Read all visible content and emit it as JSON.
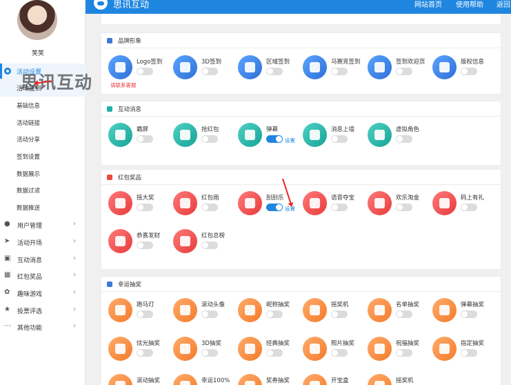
{
  "user": {
    "name": "笑笑"
  },
  "sidebar": {
    "top_item": "活动设置",
    "top_sub": "活动签到",
    "sub_items": [
      "基础信息",
      "活动链接",
      "活动分享",
      "签到设置",
      "数据展示",
      "数据过滤",
      "数据推送"
    ],
    "groups": [
      {
        "label": "用户管理",
        "icon": "user-icon"
      },
      {
        "label": "活动开场",
        "icon": "send-icon"
      },
      {
        "label": "互动消息",
        "icon": "message-icon"
      },
      {
        "label": "红包奖品",
        "icon": "gift-icon"
      },
      {
        "label": "趣味游戏",
        "icon": "game-icon"
      },
      {
        "label": "投票评选",
        "icon": "star-icon"
      },
      {
        "label": "其他功能",
        "icon": "more-icon"
      }
    ]
  },
  "header": {
    "title": "思讯互动",
    "links": [
      "网站首页",
      "使用帮助",
      "返回"
    ]
  },
  "watermark": "思讯互动",
  "sections": [
    {
      "title": "品牌形象",
      "icon": "brand-icon",
      "color": "#3a7bd5",
      "tiles": [
        {
          "label": "Logo签到",
          "on": false,
          "grad": "linear-gradient(135deg,#5aa5ff,#2f6fd6)",
          "contact": "请联系客服"
        },
        {
          "label": "3D签到",
          "on": false,
          "grad": "linear-gradient(135deg,#5aa5ff,#2f6fd6)"
        },
        {
          "label": "区域签到",
          "on": false,
          "grad": "linear-gradient(135deg,#5aa5ff,#2f6fd6)"
        },
        {
          "label": "马赛克签到",
          "on": false,
          "grad": "linear-gradient(135deg,#5aa5ff,#2f6fd6)"
        },
        {
          "label": "签到欢迎页",
          "on": false,
          "grad": "linear-gradient(135deg,#5aa5ff,#2f6fd6)"
        },
        {
          "label": "版权信息",
          "on": false,
          "grad": "linear-gradient(135deg,#5aa5ff,#2f6fd6)"
        }
      ]
    },
    {
      "title": "互动消息",
      "icon": "chat-icon",
      "color": "#20b2aa",
      "tiles": [
        {
          "label": "霸屏",
          "on": false,
          "grad": "linear-gradient(135deg,#4fd1c5,#17a397)"
        },
        {
          "label": "抢红包",
          "on": false,
          "grad": "linear-gradient(135deg,#4fd1c5,#17a397)"
        },
        {
          "label": "弹幕",
          "on": true,
          "grad": "linear-gradient(135deg,#4fd1c5,#17a397)",
          "set": "设置"
        },
        {
          "label": "消息上墙",
          "on": false,
          "grad": "linear-gradient(135deg,#4fd1c5,#17a397)"
        },
        {
          "label": "虚拟角色",
          "on": false,
          "grad": "linear-gradient(135deg,#4fd1c5,#17a397)"
        }
      ]
    },
    {
      "title": "红包奖品",
      "icon": "redpacket-icon",
      "color": "#e84c3d",
      "tiles": [
        {
          "label": "摇大奖",
          "on": false,
          "grad": "linear-gradient(135deg,#ff7a7a,#e83b3b)"
        },
        {
          "label": "红包雨",
          "on": false,
          "grad": "linear-gradient(135deg,#ff7a7a,#e83b3b)"
        },
        {
          "label": "刮刮乐",
          "on": true,
          "grad": "linear-gradient(135deg,#ff7a7a,#e83b3b)",
          "set": "设置"
        },
        {
          "label": "语音夺宝",
          "on": false,
          "grad": "linear-gradient(135deg,#ff7a7a,#e83b3b)"
        },
        {
          "label": "欢乐淘金",
          "on": false,
          "grad": "linear-gradient(135deg,#ff7a7a,#e83b3b)"
        },
        {
          "label": "码上有礼",
          "on": false,
          "grad": "linear-gradient(135deg,#ff7a7a,#e83b3b)"
        },
        {
          "label": "恭喜发财",
          "on": false,
          "grad": "linear-gradient(135deg,#ff7a7a,#e83b3b)"
        },
        {
          "label": "红包总榜",
          "on": false,
          "grad": "linear-gradient(135deg,#ff7a7a,#e83b3b)"
        }
      ]
    },
    {
      "title": "幸运抽奖",
      "icon": "lottery-icon",
      "color": "#3a7bd5",
      "tiles": [
        {
          "label": "跑马灯",
          "on": false,
          "grad": "linear-gradient(135deg,#ffac6b,#f47a2a)"
        },
        {
          "label": "滚动头像",
          "on": false,
          "grad": "linear-gradient(135deg,#ffac6b,#f47a2a)"
        },
        {
          "label": "昵称抽奖",
          "on": false,
          "grad": "linear-gradient(135deg,#ffac6b,#f47a2a)"
        },
        {
          "label": "摇奖机",
          "on": false,
          "grad": "linear-gradient(135deg,#ffac6b,#f47a2a)"
        },
        {
          "label": "名单抽奖",
          "on": false,
          "grad": "linear-gradient(135deg,#ffac6b,#f47a2a)"
        },
        {
          "label": "弹幕抽奖",
          "on": false,
          "grad": "linear-gradient(135deg,#ffac6b,#f47a2a)"
        },
        {
          "label": "炫光抽奖",
          "on": false,
          "grad": "linear-gradient(135deg,#ffac6b,#f47a2a)"
        },
        {
          "label": "3D抽奖",
          "on": false,
          "grad": "linear-gradient(135deg,#ffac6b,#f47a2a)"
        },
        {
          "label": "经典抽奖",
          "on": false,
          "grad": "linear-gradient(135deg,#ffac6b,#f47a2a)"
        },
        {
          "label": "照片抽奖",
          "on": false,
          "grad": "linear-gradient(135deg,#ffac6b,#f47a2a)"
        },
        {
          "label": "祝福抽奖",
          "on": false,
          "grad": "linear-gradient(135deg,#ffac6b,#f47a2a)"
        },
        {
          "label": "指定抽奖",
          "on": false,
          "grad": "linear-gradient(135deg,#ffac6b,#f47a2a)"
        },
        {
          "label": "滚动抽奖",
          "on": false,
          "grad": "linear-gradient(135deg,#ffac6b,#f47a2a)"
        },
        {
          "label": "幸运100%",
          "on": false,
          "grad": "linear-gradient(135deg,#ffac6b,#f47a2a)"
        },
        {
          "label": "奖券抽奖",
          "on": false,
          "grad": "linear-gradient(135deg,#ffac6b,#f47a2a)"
        },
        {
          "label": "开宝盒",
          "on": false,
          "grad": "linear-gradient(135deg,#ffac6b,#f47a2a)"
        },
        {
          "label": "摇奖机",
          "on": false,
          "grad": "linear-gradient(135deg,#ffac6b,#f47a2a)"
        }
      ]
    }
  ]
}
